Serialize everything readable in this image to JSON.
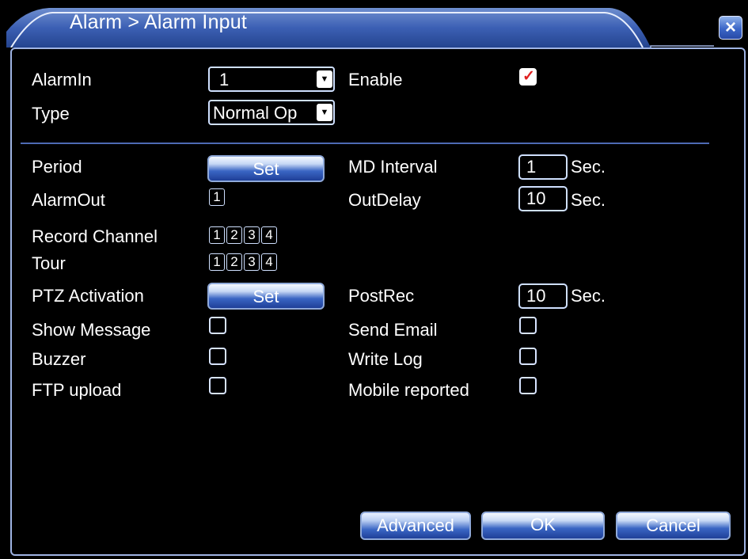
{
  "window": {
    "title": "Alarm > Alarm Input",
    "close_label": "×"
  },
  "alarm_in": {
    "label": "AlarmIn",
    "value": "1"
  },
  "enable": {
    "label": "Enable",
    "checked": true
  },
  "type": {
    "label": "Type",
    "value": "Normal Op"
  },
  "period": {
    "label": "Period",
    "button": "Set"
  },
  "md_interval": {
    "label": "MD Interval",
    "value": "1",
    "unit": "Sec."
  },
  "alarm_out": {
    "label": "AlarmOut",
    "channels": [
      "1"
    ]
  },
  "out_delay": {
    "label": "OutDelay",
    "value": "10",
    "unit": "Sec."
  },
  "record_channel": {
    "label": "Record Channel",
    "channels": [
      "1",
      "2",
      "3",
      "4"
    ]
  },
  "tour": {
    "label": "Tour",
    "channels": [
      "1",
      "2",
      "3",
      "4"
    ]
  },
  "ptz_activation": {
    "label": "PTZ Activation",
    "button": "Set"
  },
  "post_rec": {
    "label": "PostRec",
    "value": "10",
    "unit": "Sec."
  },
  "show_message": {
    "label": "Show Message",
    "checked": false
  },
  "send_email": {
    "label": "Send Email",
    "checked": false
  },
  "buzzer": {
    "label": "Buzzer",
    "checked": false
  },
  "write_log": {
    "label": "Write Log",
    "checked": false
  },
  "ftp_upload": {
    "label": "FTP upload",
    "checked": false
  },
  "mobile_reported": {
    "label": "Mobile reported",
    "checked": false
  },
  "footer": {
    "advanced": "Advanced",
    "ok": "OK",
    "cancel": "Cancel"
  },
  "colors": {
    "accent": "#3a66c4",
    "check_mark": "#e02020",
    "border": "#9fb4e4"
  }
}
